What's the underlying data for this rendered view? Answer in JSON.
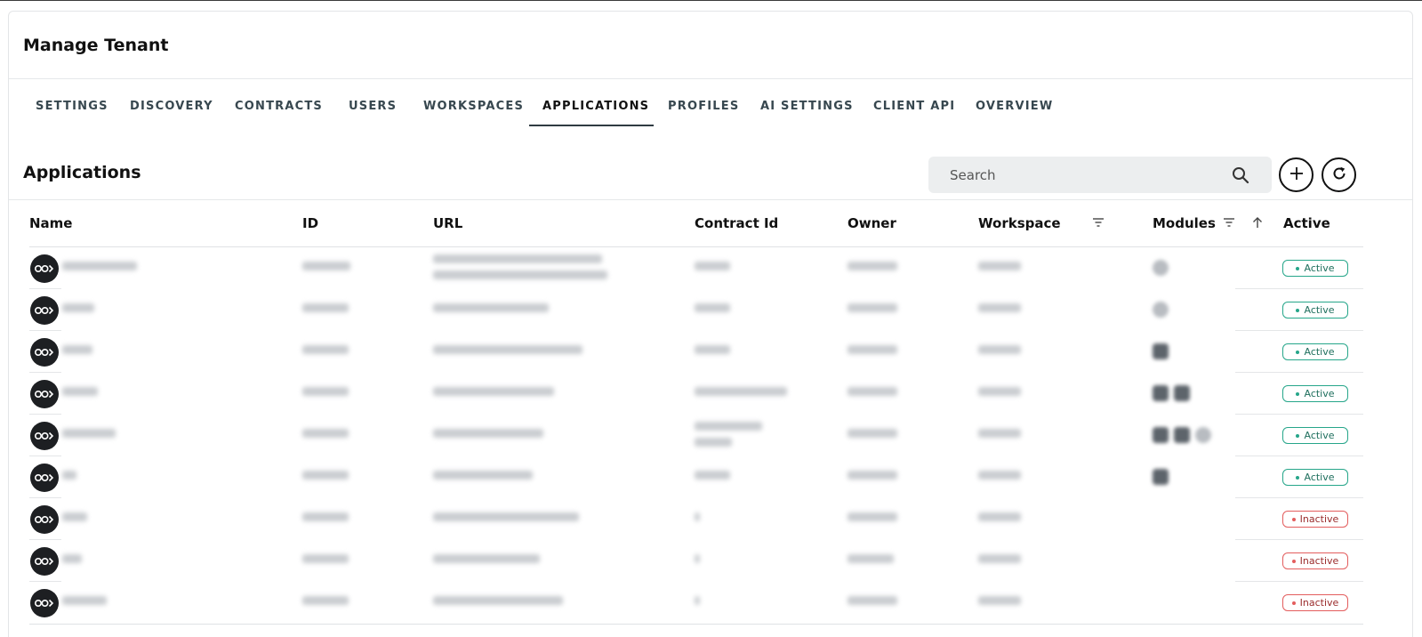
{
  "page": {
    "title": "Manage Tenant",
    "section_title": "Applications"
  },
  "tabs": [
    {
      "label": "SETTINGS",
      "active": false
    },
    {
      "label": "DISCOVERY",
      "active": false
    },
    {
      "label": "CONTRACTS",
      "active": false
    },
    {
      "label": "USERS",
      "active": false
    },
    {
      "label": "WORKSPACES",
      "active": false
    },
    {
      "label": "APPLICATIONS",
      "active": true
    },
    {
      "label": "PROFILES",
      "active": false
    },
    {
      "label": "AI SETTINGS",
      "active": false
    },
    {
      "label": "CLIENT API",
      "active": false
    },
    {
      "label": "OVERVIEW",
      "active": false
    }
  ],
  "search": {
    "placeholder": "Search",
    "value": "",
    "icon": "search-icon"
  },
  "actions": {
    "add_icon": "plus-icon",
    "refresh_icon": "refresh-icon"
  },
  "table": {
    "columns": {
      "name": "Name",
      "id": "ID",
      "url": "URL",
      "contract_id": "Contract Id",
      "owner": "Owner",
      "workspace": "Workspace",
      "modules": "Modules",
      "active": "Active"
    },
    "rows": [
      {
        "status": "Active",
        "active": true
      },
      {
        "status": "Active",
        "active": true
      },
      {
        "status": "Active",
        "active": true
      },
      {
        "status": "Active",
        "active": true
      },
      {
        "status": "Active",
        "active": true
      },
      {
        "status": "Active",
        "active": true
      },
      {
        "status": "Inactive",
        "active": false
      },
      {
        "status": "Inactive",
        "active": false
      },
      {
        "status": "Inactive",
        "active": false
      }
    ]
  },
  "colors": {
    "active_badge": "#26a68a",
    "inactive_badge": "#e35d5d",
    "avatar_bg": "#1d1f22",
    "search_bg": "#eceeef"
  }
}
